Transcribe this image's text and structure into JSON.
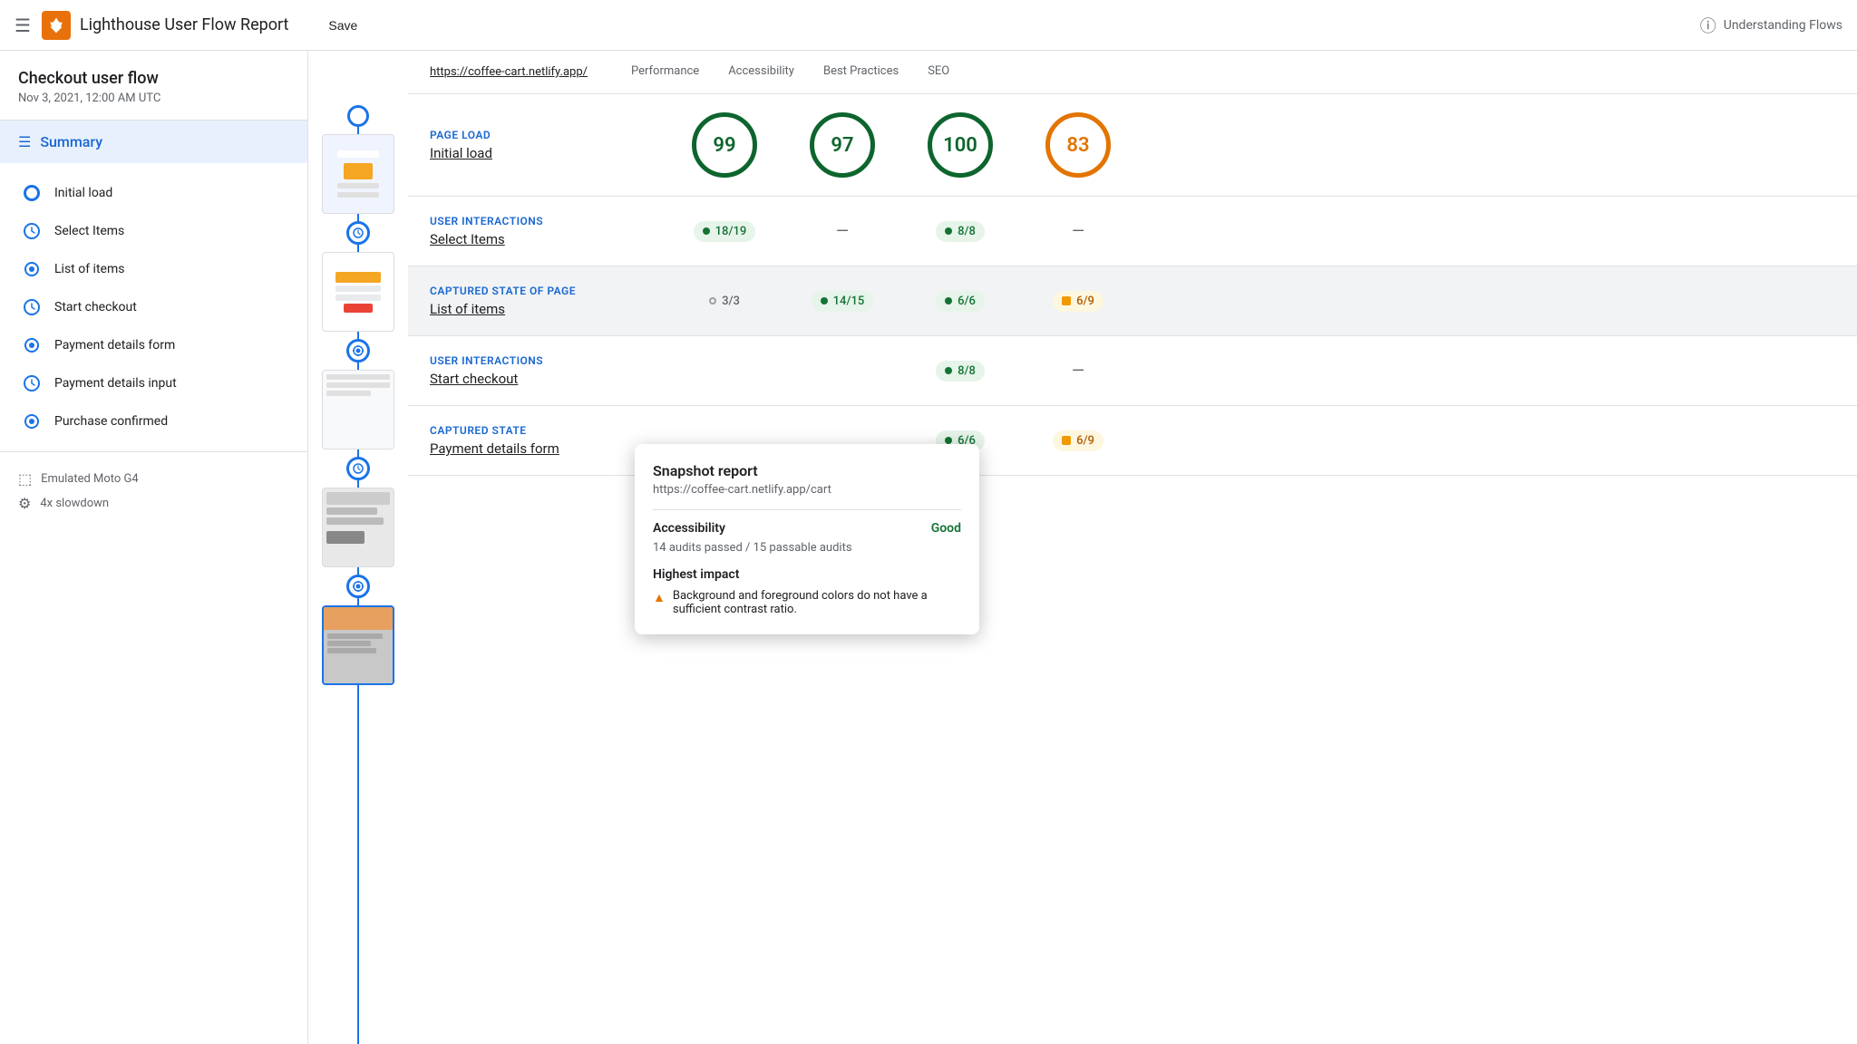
{
  "header": {
    "menu_label": "☰",
    "title": "Lighthouse User Flow Report",
    "save_label": "Save",
    "help_label": "Understanding Flows"
  },
  "sidebar": {
    "flow_title": "Checkout user flow",
    "flow_date": "Nov 3, 2021, 12:00 AM UTC",
    "summary_label": "Summary",
    "steps": [
      {
        "id": "initial-load",
        "label": "Initial load",
        "type": "pageload"
      },
      {
        "id": "select-items",
        "label": "Select Items",
        "type": "interaction"
      },
      {
        "id": "list-of-items",
        "label": "List of items",
        "type": "snapshot"
      },
      {
        "id": "start-checkout",
        "label": "Start checkout",
        "type": "interaction"
      },
      {
        "id": "payment-details-form",
        "label": "Payment details form",
        "type": "snapshot"
      },
      {
        "id": "payment-details-input",
        "label": "Payment details input",
        "type": "interaction"
      },
      {
        "id": "purchase-confirmed",
        "label": "Purchase confirmed",
        "type": "snapshot"
      }
    ],
    "footer": [
      {
        "label": "Emulated Moto G4",
        "icon": "device"
      },
      {
        "label": "4x slowdown",
        "icon": "speed"
      }
    ]
  },
  "tabbar": {
    "url": "https://coffee-cart.netlify.app/",
    "tabs": [
      "Performance",
      "Accessibility",
      "Best Practices",
      "SEO"
    ]
  },
  "sections": [
    {
      "type": "Page load",
      "name": "Initial load",
      "scores": [
        {
          "kind": "circle",
          "value": "99",
          "color": "green",
          "col": "performance"
        },
        {
          "kind": "circle",
          "value": "97",
          "color": "green",
          "col": "accessibility"
        },
        {
          "kind": "circle",
          "value": "100",
          "color": "green",
          "col": "best-practices"
        },
        {
          "kind": "circle",
          "value": "83",
          "color": "orange",
          "col": "seo"
        }
      ]
    },
    {
      "type": "User interactions",
      "name": "Select Items",
      "scores": [
        {
          "kind": "badge",
          "value": "18/19",
          "color": "green",
          "col": "performance"
        },
        {
          "kind": "dash",
          "col": "accessibility"
        },
        {
          "kind": "badge",
          "value": "8/8",
          "color": "green",
          "col": "best-practices"
        },
        {
          "kind": "dash",
          "col": "seo"
        }
      ]
    },
    {
      "type": "Captured state of page",
      "name": "List of items",
      "scores": [
        {
          "kind": "badge",
          "value": "3/3",
          "color": "gray",
          "col": "performance"
        },
        {
          "kind": "badge",
          "value": "14/15",
          "color": "green",
          "col": "accessibility"
        },
        {
          "kind": "badge",
          "value": "6/6",
          "color": "green",
          "col": "best-practices"
        },
        {
          "kind": "badge",
          "value": "6/9",
          "color": "orange",
          "col": "seo"
        }
      ]
    },
    {
      "type": "User interactions",
      "name": "Start checkout",
      "scores": [
        {
          "kind": "hidden",
          "col": "performance"
        },
        {
          "kind": "hidden",
          "col": "accessibility"
        },
        {
          "kind": "badge",
          "value": "8/8",
          "color": "green",
          "col": "best-practices"
        },
        {
          "kind": "dash",
          "col": "seo"
        }
      ]
    },
    {
      "type": "Captured state",
      "name": "Payment details form",
      "scores": [
        {
          "kind": "hidden",
          "col": "performance"
        },
        {
          "kind": "hidden",
          "col": "accessibility"
        },
        {
          "kind": "badge",
          "value": "6/6",
          "color": "green",
          "col": "best-practices"
        },
        {
          "kind": "badge",
          "value": "6/9",
          "color": "orange",
          "col": "seo"
        }
      ]
    }
  ],
  "popup": {
    "title": "Snapshot report",
    "url": "https://coffee-cart.netlify.app/cart",
    "accessibility_label": "Accessibility",
    "accessibility_value": "Good",
    "accessibility_desc": "14 audits passed / 15 passable audits",
    "highest_impact_label": "Highest impact",
    "warning_text": "Background and foreground colors do not have a sufficient contrast ratio."
  }
}
